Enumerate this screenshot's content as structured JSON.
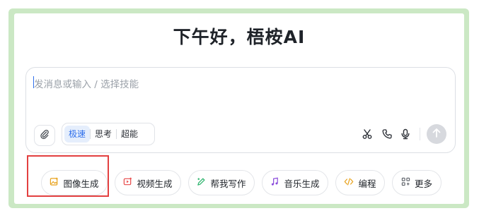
{
  "greeting": "下午好，梧桉AI",
  "input": {
    "placeholder": "发消息或输入 / 选择技能"
  },
  "modes": [
    {
      "label": "极速",
      "active": true
    },
    {
      "label": "思考",
      "active": false
    },
    {
      "label": "超能",
      "active": false
    }
  ],
  "toolbar": {
    "attach_icon": "paperclip-icon",
    "tools": [
      "scissors-icon",
      "phone-icon",
      "microphone-icon"
    ],
    "send_icon": "arrow-up-icon"
  },
  "skills": [
    {
      "label": "图像生成",
      "icon": "image-icon",
      "color": "#e8a21c",
      "highlighted": true
    },
    {
      "label": "视频生成",
      "icon": "video-icon",
      "color": "#e84a4a"
    },
    {
      "label": "帮我写作",
      "icon": "pen-icon",
      "color": "#2bb36b"
    },
    {
      "label": "音乐生成",
      "icon": "music-icon",
      "color": "#8a4bdb"
    },
    {
      "label": "编程",
      "icon": "code-icon",
      "color": "#e8a21c"
    },
    {
      "label": "更多",
      "icon": "grid-icon",
      "color": "#5a5f66"
    }
  ],
  "colors": {
    "frame": "#cbe8c4",
    "accent": "#2f6feb",
    "highlight": "#e34040"
  }
}
